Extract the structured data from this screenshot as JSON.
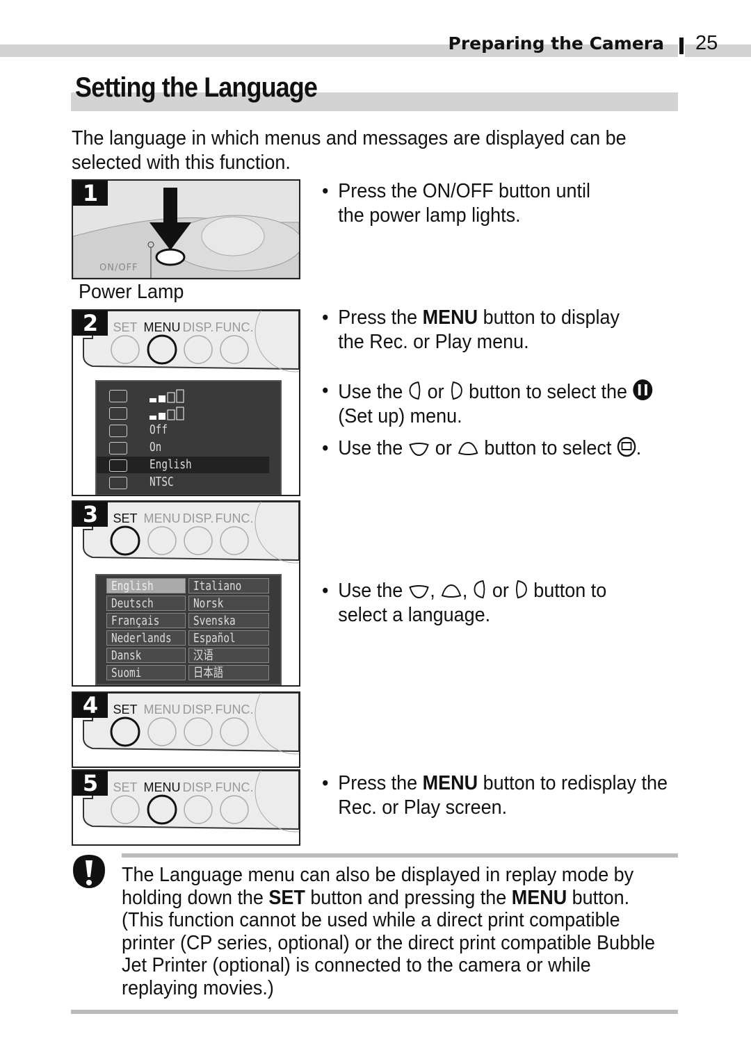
{
  "header": {
    "section": "Preparing the Camera",
    "page_number": "25"
  },
  "title": "Setting the Language",
  "intro": "The language in which menus and messages are displayed can be selected with this function.",
  "steps": [
    {
      "number": "1",
      "caption": "Power Lamp",
      "label": "ON/OFF"
    },
    {
      "number": "2",
      "buttons": [
        "SET",
        "MENU",
        "DISP.",
        "FUNC."
      ],
      "active": "MENU",
      "menu": [
        {
          "value": ""
        },
        {
          "value": ""
        },
        {
          "value": "Off"
        },
        {
          "value": "On"
        },
        {
          "value": "English",
          "selected": true
        },
        {
          "value": "NTSC"
        }
      ]
    },
    {
      "number": "3",
      "buttons": [
        "SET",
        "MENU",
        "DISP.",
        "FUNC."
      ],
      "active": "SET",
      "languages": [
        [
          "English",
          "Italiano"
        ],
        [
          "Deutsch",
          "Norsk"
        ],
        [
          "Français",
          "Svenska"
        ],
        [
          "Nederlands",
          "Español"
        ],
        [
          "Dansk",
          "汉语"
        ],
        [
          "Suomi",
          "日本語"
        ]
      ],
      "selected_language": "English"
    },
    {
      "number": "4",
      "buttons": [
        "SET",
        "MENU",
        "DISP.",
        "FUNC."
      ],
      "active": "SET"
    },
    {
      "number": "5",
      "buttons": [
        "SET",
        "MENU",
        "DISP.",
        "FUNC."
      ],
      "active": "MENU"
    }
  ],
  "instructions": {
    "b1": {
      "text": "Press the ON/OFF button until the power lamp lights."
    },
    "b2": {
      "pre": "Press the ",
      "bold": "MENU",
      "post": " button to display the Rec. or Play menu."
    },
    "b3": {
      "a": "Use the ",
      "or": " or ",
      "b": " button to select the ",
      "c": " (Set up) menu."
    },
    "b4": {
      "a": "Use the ",
      "or": " or ",
      "b": " button to select ",
      "c": "."
    },
    "b5": {
      "a": "Use the ",
      "comma1": ", ",
      "comma2": ", ",
      "or": " or ",
      "b": " button to select a language."
    },
    "b6": {
      "pre": "Press the ",
      "bold": "MENU",
      "post": " button to redisplay the Rec. or Play screen."
    }
  },
  "note": {
    "icon": "caution-icon",
    "t1": "The Language menu can also be displayed in replay mode by holding down the ",
    "set": "SET",
    "t2": " button and pressing the ",
    "menu": "MENU",
    "t3": " button. (This function cannot be used while a direct print compatible printer (CP series, optional) or the direct print compatible Bubble Jet Printer (optional) is connected to the camera or while replaying movies.)"
  },
  "bullet_char": "•"
}
